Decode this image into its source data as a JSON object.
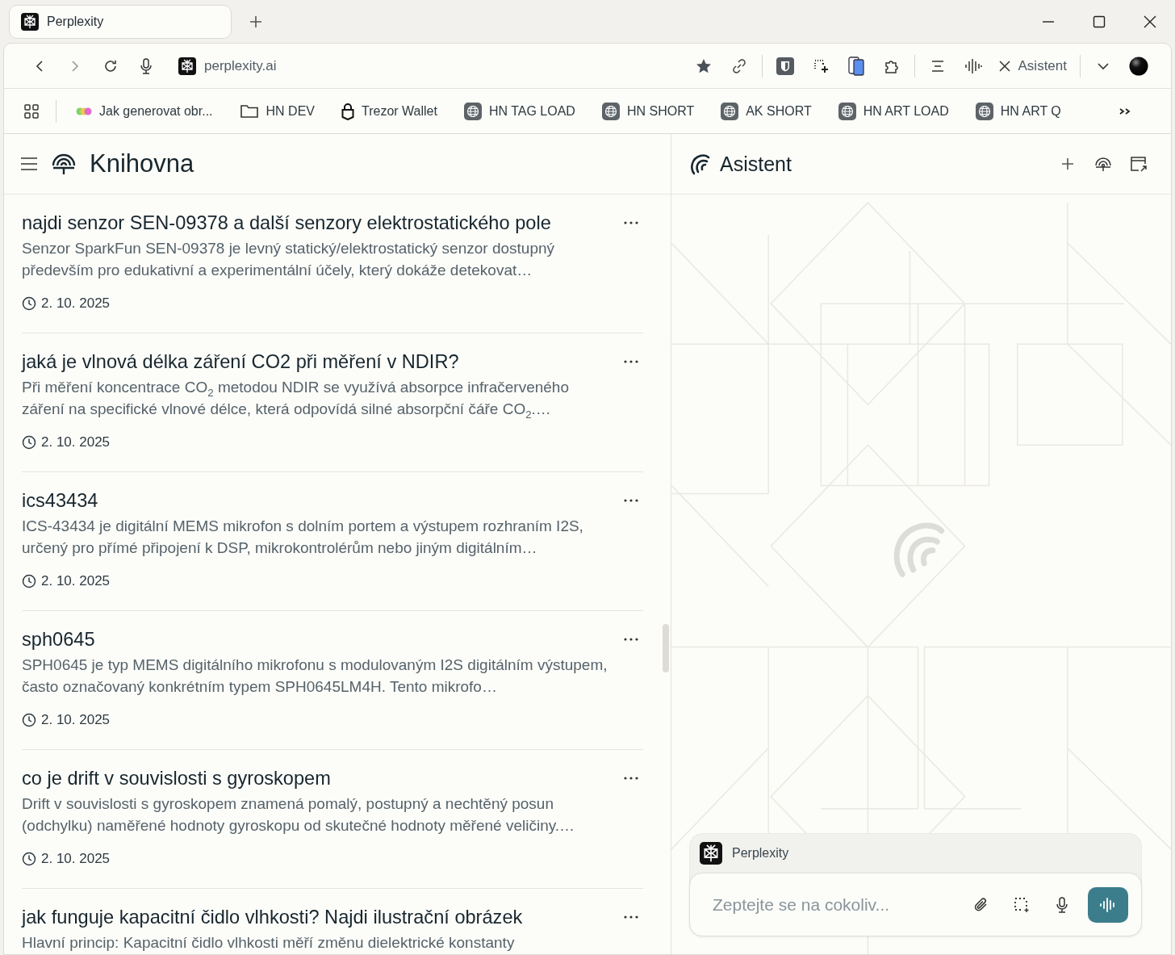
{
  "browser_tab": {
    "title": "Perplexity",
    "selected": true
  },
  "address_bar": {
    "url": "perplexity.ai"
  },
  "toolbar": {
    "assistant_button": "Asistent"
  },
  "bookmarks": [
    {
      "label": "Jak generovat obr...",
      "kind": "dots"
    },
    {
      "label": "HN DEV",
      "kind": "folder"
    },
    {
      "label": "Trezor Wallet",
      "kind": "lock"
    },
    {
      "label": "HN TAG LOAD",
      "kind": "globe"
    },
    {
      "label": "HN SHORT",
      "kind": "globe"
    },
    {
      "label": "AK SHORT",
      "kind": "globe"
    },
    {
      "label": "HN ART LOAD",
      "kind": "globe"
    },
    {
      "label": "HN ART Q",
      "kind": "globe"
    }
  ],
  "library": {
    "title": "Knihovna",
    "threads": [
      {
        "title": "najdi senzor SEN-09378 a další senzory elektrostatického pole",
        "snippet": "Senzor SparkFun SEN-09378 je levný statický/elektrostatický senzor dostupný především pro edukativní a experimentální účely, který dokáže detekovat…",
        "date": "2. 10. 2025"
      },
      {
        "title": "jaká je vlnová délka záření CO2 při měření v NDIR?",
        "snippet": "Při měření koncentrace CO$_{2}$ metodou NDIR se využívá absorpce infračerveného záření na specifické vlnové délce, která odpovídá silné absorpční čáře CO$_{2}$.…",
        "date": "2. 10. 2025"
      },
      {
        "title": "ics43434",
        "snippet": "ICS-43434 je digitální MEMS mikrofon s dolním portem a výstupem rozhraním I2S, určený pro přímé připojení k DSP, mikrokontrolérům nebo jiným digitálním…",
        "date": "2. 10. 2025"
      },
      {
        "title": "sph0645",
        "snippet": "SPH0645 je typ MEMS digitálního mikrofonu s modulovaným I2S digitálním výstupem, často označovaný konkrétním typem SPH0645LM4H. Tento mikrofo…",
        "date": "2. 10. 2025"
      },
      {
        "title": "co je drift v souvislosti s gyroskopem",
        "snippet": "Drift v souvislosti s gyroskopem znamená pomalý, postupný a nechtěný posun (odchylku) naměřené hodnoty gyroskopu od skutečné hodnoty měřené veličiny.…",
        "date": "2. 10. 2025"
      },
      {
        "title": "jak funguje kapacitní čidlo vlhkosti? Najdi ilustrační obrázek",
        "snippet": "Hlavní princip: Kapacitní čidlo vlhkosti měří změnu dielektrické konstanty"
      }
    ]
  },
  "assistant": {
    "title": "Asistent",
    "source": "Perplexity",
    "input": {
      "placeholder": "Zeptejte se na cokoliv..."
    }
  }
}
